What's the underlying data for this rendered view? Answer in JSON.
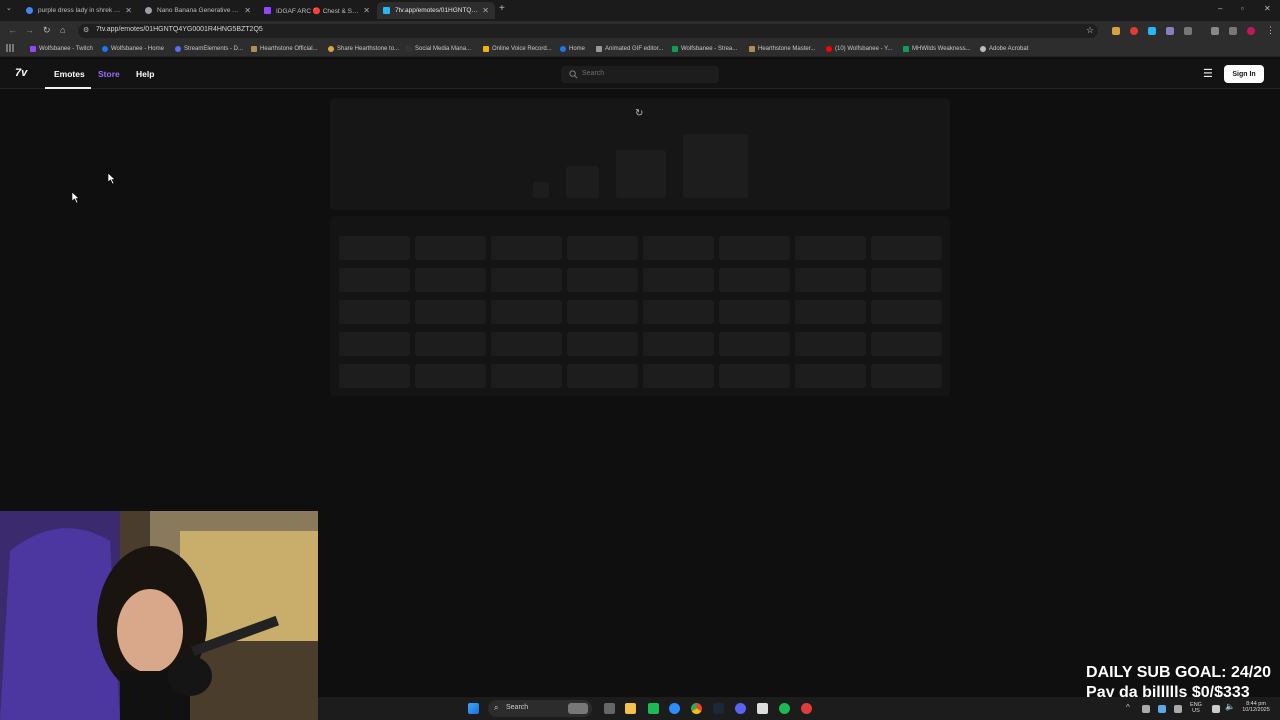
{
  "browser": {
    "tabs": [
      {
        "title": "purple dress lady in shrek - Go",
        "favicon_color": "#4285f4",
        "active": false
      },
      {
        "title": "Nano Banana Generative AI M",
        "favicon_color": "#9aa0a6",
        "active": false
      },
      {
        "title": "IDGAF ARC 🔴 Chest & Should",
        "favicon_color": "#9146ff",
        "active": false
      },
      {
        "title": "7tv.app/emotes/01HGNTQ4YG",
        "favicon_color": "#29b6f6",
        "active": true
      }
    ],
    "new_tab": "+",
    "window_controls": {
      "minimize": "–",
      "maximize": "▫",
      "close": "✕"
    },
    "url": "7tv.app/emotes/01HGNTQ4YG0001R4HNG5BZT2Q5",
    "bookmarks": [
      {
        "label": "Wolfsbanee - Twitch",
        "color": "#9146ff"
      },
      {
        "label": "Wolfsbanee - Home",
        "color": "#1877f2"
      },
      {
        "label": "StreamElements - D...",
        "color": "#5b6cff"
      },
      {
        "label": "Hearthstone Official...",
        "color": "#b08d57"
      },
      {
        "label": "Share Hearthstone to...",
        "color": "#d9a441"
      },
      {
        "label": "Social Media Mana...",
        "color": "#333333"
      },
      {
        "label": "Online Voice Record...",
        "color": "#f4b400"
      },
      {
        "label": "Home",
        "color": "#1877f2"
      },
      {
        "label": "Animated GIF editor...",
        "color": "#999999"
      },
      {
        "label": "Wolfsbanee - Strea...",
        "color": "#0f9d58"
      },
      {
        "label": "Hearthstone Master...",
        "color": "#b08d57"
      },
      {
        "label": "(10) Wolfsbanee - Y...",
        "color": "#ff0000"
      },
      {
        "label": "MHWilds Weakness...",
        "color": "#0f9d58"
      },
      {
        "label": "Adobe Acrobat",
        "color": "#bbbbbb"
      }
    ]
  },
  "site": {
    "logo": "7v",
    "nav": {
      "emotes": "Emotes",
      "store": "Store",
      "help": "Help"
    },
    "search_placeholder": "Search",
    "menu_icon": "☰",
    "sign_in": "Sign In",
    "loading_spinner": "↻"
  },
  "overlay": {
    "line1": "DAILY SUB GOAL: 24/20",
    "line2": "Pay da billllls $0/$333"
  },
  "taskbar": {
    "search": "Search",
    "lang_top": "ENG",
    "lang_bottom": "US",
    "time": "8:44 pm",
    "date": "10/12/2025"
  },
  "colors": {
    "store_link": "#9f6bff",
    "page_bg": "#0f0f0f"
  }
}
